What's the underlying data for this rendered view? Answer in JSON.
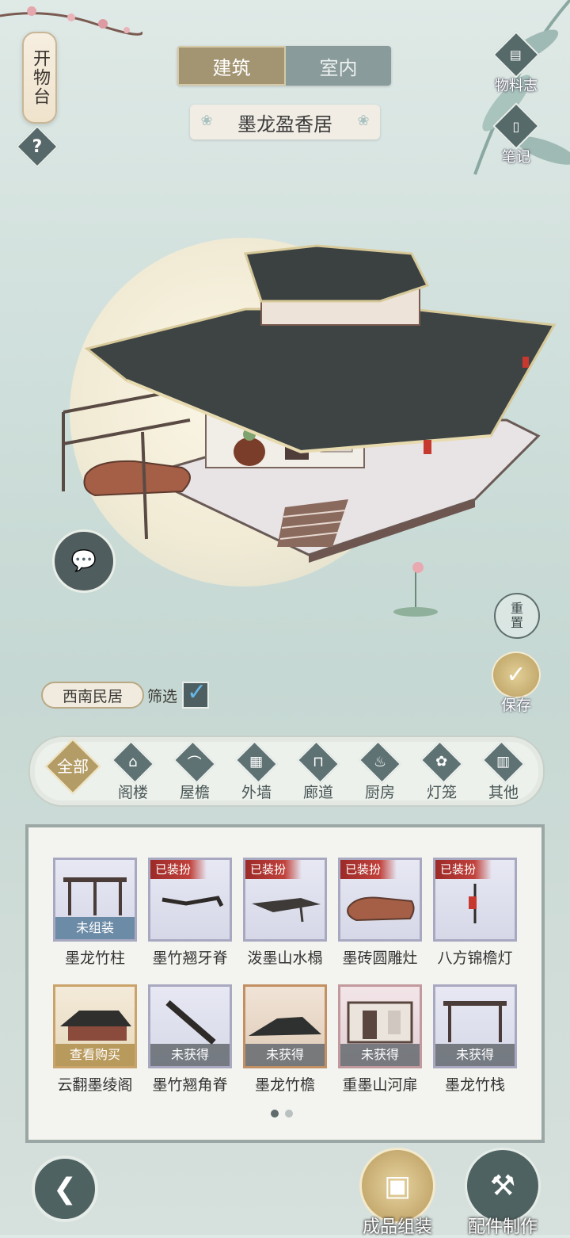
{
  "lantern": {
    "label": "开物台"
  },
  "help": {
    "label": "?"
  },
  "tabs": [
    {
      "label": "建筑"
    },
    {
      "label": "室内"
    }
  ],
  "building_title": "墨龙盈香居",
  "side_buttons": {
    "materials": "物料志",
    "notes": "笔记"
  },
  "reset": {
    "label_1": "重",
    "label_2": "置"
  },
  "save": {
    "label": "保存"
  },
  "filter": {
    "region": "西南民居",
    "filter_label": "筛选",
    "checked": true
  },
  "categories": [
    {
      "label": "全部",
      "icon": "all-icon"
    },
    {
      "label": "阁楼",
      "icon": "pavilion-icon"
    },
    {
      "label": "屋檐",
      "icon": "eaves-icon"
    },
    {
      "label": "外墙",
      "icon": "wall-icon"
    },
    {
      "label": "廊道",
      "icon": "corridor-icon"
    },
    {
      "label": "厨房",
      "icon": "kitchen-icon"
    },
    {
      "label": "灯笼",
      "icon": "lantern-icon"
    },
    {
      "label": "其他",
      "icon": "other-icon"
    }
  ],
  "items": [
    {
      "name": "墨龙竹柱",
      "tag": "",
      "status": "未组装",
      "frame": "blue"
    },
    {
      "name": "墨竹翘牙脊",
      "tag": "已装扮",
      "status": "",
      "frame": "blue"
    },
    {
      "name": "泼墨山水榻",
      "tag": "已装扮",
      "status": "",
      "frame": "blue"
    },
    {
      "name": "墨砖圆雕灶",
      "tag": "已装扮",
      "status": "",
      "frame": "blue"
    },
    {
      "name": "八方锦檐灯",
      "tag": "已装扮",
      "status": "",
      "frame": "blue"
    },
    {
      "name": "云翻墨绫阁",
      "tag": "",
      "status": "查看购买",
      "frame": "orange"
    },
    {
      "name": "墨竹翘角脊",
      "tag": "",
      "status": "未获得",
      "frame": "blue"
    },
    {
      "name": "墨龙竹檐",
      "tag": "",
      "status": "未获得",
      "frame": "brown"
    },
    {
      "name": "重墨山河扉",
      "tag": "",
      "status": "未获得",
      "frame": "red"
    },
    {
      "name": "墨龙竹栈",
      "tag": "",
      "status": "未获得",
      "frame": "blue"
    }
  ],
  "pagination": {
    "pages": 2,
    "current": 1
  },
  "bottom": {
    "assemble": "成品组装",
    "craft": "配件制作"
  }
}
